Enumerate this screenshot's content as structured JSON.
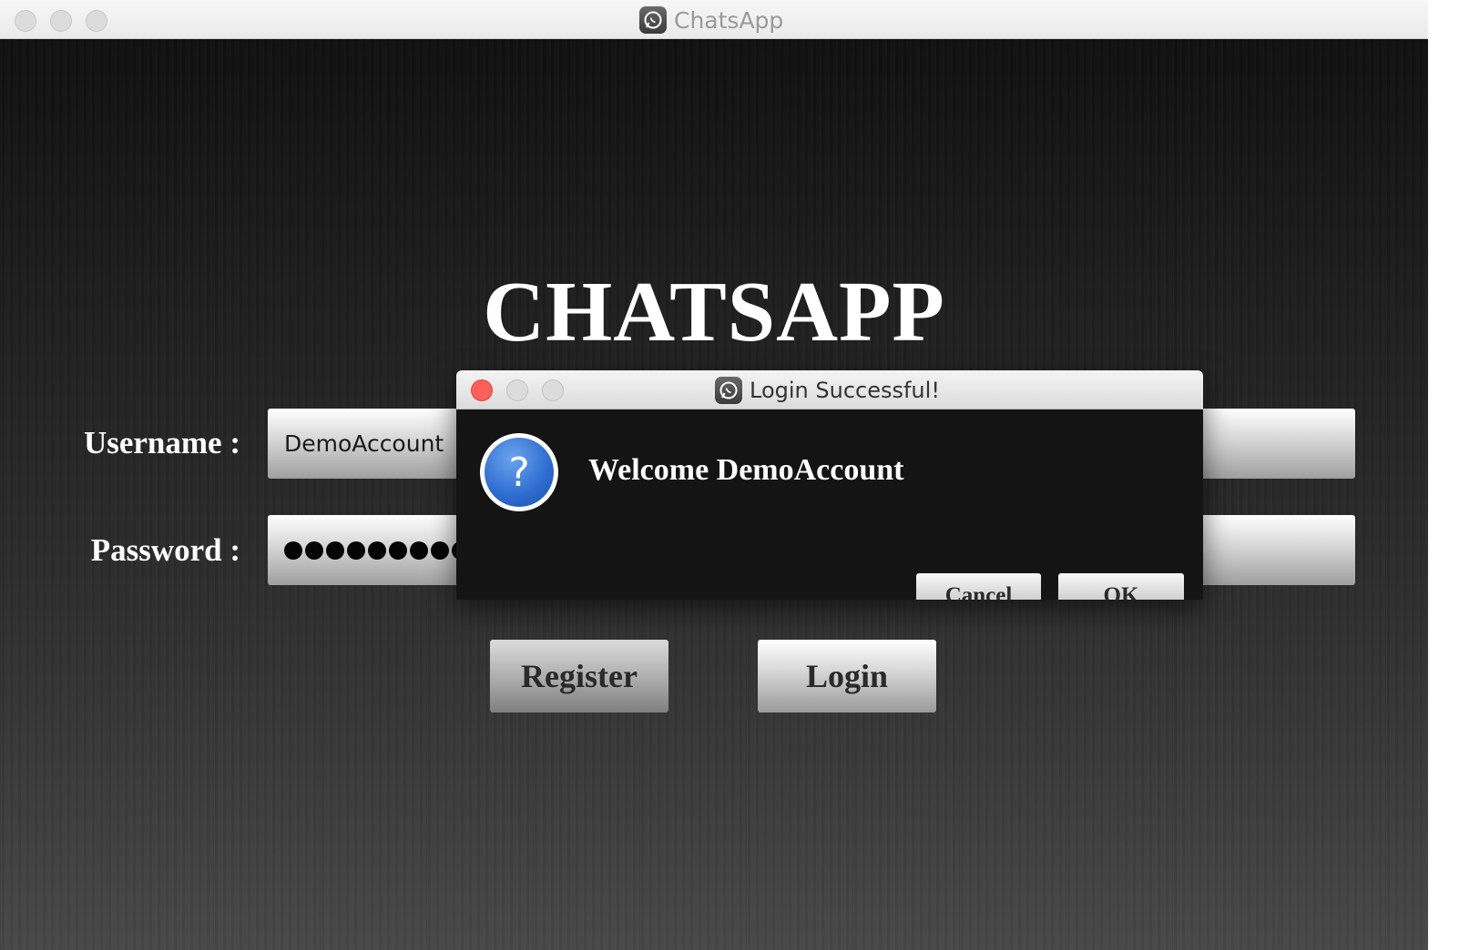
{
  "window": {
    "title": "ChatsApp",
    "app_icon": "chatsapp-logo-icon"
  },
  "login": {
    "heading": "CHATSAPP",
    "username_label": "Username :",
    "password_label": "Password :",
    "username_value": "DemoAccount",
    "password_mask_length": 9,
    "register_label": "Register",
    "login_label": "Login"
  },
  "dialog": {
    "title": "Login Successful!",
    "icon": "question-icon",
    "icon_glyph": "?",
    "message": "Welcome DemoAccount",
    "cancel_label": "Cancel",
    "ok_label": "OK"
  },
  "colors": {
    "close_button": "#fc605b",
    "question_icon": "#2d6ccf"
  }
}
